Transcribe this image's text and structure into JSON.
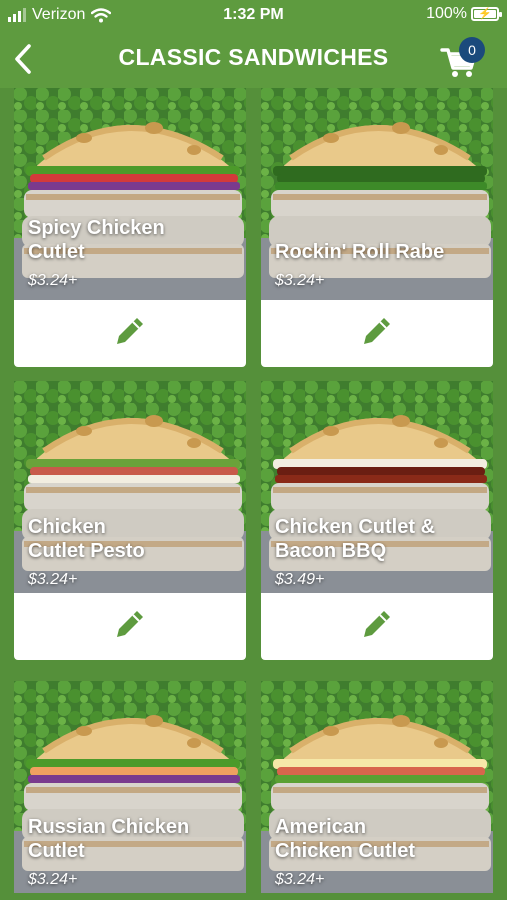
{
  "status_bar": {
    "carrier": "Verizon",
    "time": "1:32 PM",
    "battery": "100%"
  },
  "header": {
    "title": "CLASSIC SANDWICHES",
    "cart_count": "0"
  },
  "colors": {
    "brand_green": "#5e9b3f",
    "badge_blue": "#1b4a7c",
    "edit_icon": "#5e9b3f"
  },
  "items": [
    {
      "name_line1": "Spicy Chicken",
      "name_line2": "Cutlet",
      "price": "$3.24+",
      "edit_icon": "pencil-icon",
      "topping": "veggies"
    },
    {
      "name_line1": "Rockin' Roll Rabe",
      "name_line2": "",
      "price": "$3.24+",
      "edit_icon": "pencil-icon",
      "topping": "broccoli-rabe"
    },
    {
      "name_line1": "Chicken",
      "name_line2": "Cutlet Pesto",
      "price": "$3.24+",
      "edit_icon": "pencil-icon",
      "topping": "pesto"
    },
    {
      "name_line1": "Chicken Cutlet &",
      "name_line2": "Bacon BBQ",
      "price": "$3.49+",
      "edit_icon": "pencil-icon",
      "topping": "bacon-bbq"
    },
    {
      "name_line1": "Russian Chicken",
      "name_line2": "Cutlet",
      "price": "$3.24+",
      "edit_icon": "pencil-icon",
      "topping": "russian"
    },
    {
      "name_line1": "American",
      "name_line2": "Chicken Cutlet",
      "price": "$3.24+",
      "edit_icon": "pencil-icon",
      "topping": "american"
    }
  ]
}
